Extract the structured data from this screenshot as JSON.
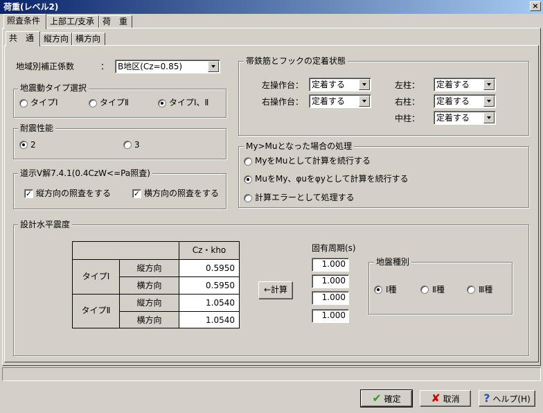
{
  "window": {
    "title": "荷重(レベル2)",
    "close_symbol": "×"
  },
  "tabs": [
    {
      "label": "照査条件",
      "active": true
    },
    {
      "label": "上部工/支承",
      "active": false
    },
    {
      "label": "荷　重",
      "active": false
    }
  ],
  "subtabs": [
    {
      "label": "共　通",
      "active": true
    },
    {
      "label": "縦方向",
      "active": false
    },
    {
      "label": "横方向",
      "active": false
    }
  ],
  "region": {
    "label": "地域別補正係数",
    "colon": "：",
    "value": "B地区(Cz=0.85)"
  },
  "seismic_type": {
    "title": "地震動タイプ選択",
    "options": [
      {
        "label": "タイプⅠ",
        "selected": false
      },
      {
        "label": "タイプⅡ",
        "selected": false
      },
      {
        "label": "タイプⅠ、Ⅱ",
        "selected": true
      }
    ]
  },
  "performance": {
    "title": "耐震性能",
    "options": [
      {
        "label": "2",
        "selected": true
      },
      {
        "label": "3",
        "selected": false
      }
    ]
  },
  "explanation": {
    "title": "道示Ⅴ解7.4.1(0.4CzW<=Pa照査)",
    "checks": [
      {
        "label": "縦方向の照査をする",
        "checked": true
      },
      {
        "label": "横方向の照査をする",
        "checked": true
      }
    ],
    "check_mark": "✓"
  },
  "anchorage": {
    "title": "帯鉄筋とフックの定着状態",
    "rows": [
      {
        "label": "左操作台：",
        "value": "定着する"
      },
      {
        "label": "右操作台：",
        "value": "定着する"
      },
      {
        "label": "左柱：",
        "value": "定着する"
      },
      {
        "label": "右柱：",
        "value": "定着する"
      },
      {
        "label": "中柱：",
        "value": "定着する"
      }
    ]
  },
  "mymu": {
    "title": "My>Muとなった場合の処理",
    "options": [
      {
        "label": "MyをMuとして計算を続行する",
        "selected": false
      },
      {
        "label": "MuをMy、φuをφyとして計算を続行する",
        "selected": true
      },
      {
        "label": "計算エラーとして処理する",
        "selected": false
      }
    ]
  },
  "design": {
    "title": "設計水平震度",
    "table": {
      "header": "Cz・kho",
      "groups": [
        {
          "label": "タイプⅠ",
          "rows": [
            {
              "dir": "縦方向",
              "value": "0.5950"
            },
            {
              "dir": "横方向",
              "value": "0.5950"
            }
          ]
        },
        {
          "label": "タイプⅡ",
          "rows": [
            {
              "dir": "縦方向",
              "value": "1.0540"
            },
            {
              "dir": "横方向",
              "value": "1.0540"
            }
          ]
        }
      ]
    },
    "calc_button": "←計算",
    "period_label": "固有周期(s)",
    "periods": [
      "1.000",
      "1.000",
      "1.000",
      "1.000"
    ],
    "ground": {
      "title": "地盤種別",
      "options": [
        {
          "label": "Ⅰ種",
          "selected": true
        },
        {
          "label": "Ⅱ種",
          "selected": false
        },
        {
          "label": "Ⅲ種",
          "selected": false
        }
      ]
    }
  },
  "buttons": {
    "ok": "確定",
    "cancel": "取消",
    "help": "ヘルプ(H)"
  },
  "colors": {
    "title_bar": "#0a246a",
    "face": "#d4d0c8",
    "ok_icon": "#2a9d2a",
    "cancel_icon": "#cc0000",
    "help_icon": "#1a56c4"
  }
}
